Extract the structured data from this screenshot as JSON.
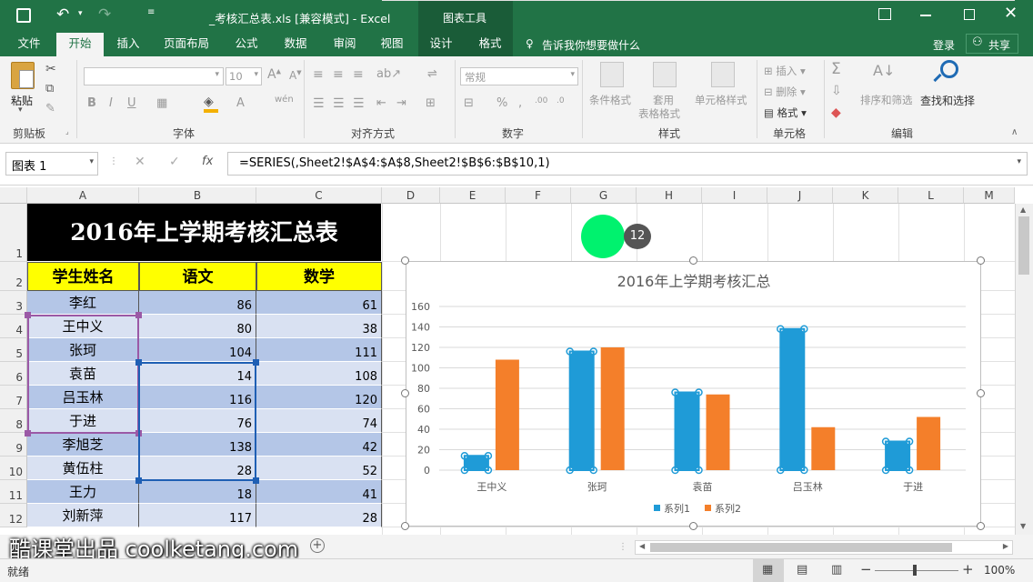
{
  "window": {
    "title": "_考核汇总表.xls  [兼容模式] - Excel",
    "context_tools": "图表工具",
    "login": "登录",
    "share": "共享"
  },
  "tabs": [
    "文件",
    "开始",
    "插入",
    "页面布局",
    "公式",
    "数据",
    "审阅",
    "视图",
    "设计",
    "格式"
  ],
  "tell_me": "告诉我你想要做什么",
  "ribbon": {
    "paste": "粘贴",
    "groups": [
      "剪贴板",
      "字体",
      "对齐方式",
      "数字",
      "样式",
      "单元格",
      "编辑"
    ],
    "font_size": "10",
    "number_format": "常规",
    "conditional_format": "条件格式",
    "table_format_1": "套用",
    "table_format_2": "表格格式",
    "cell_style": "单元格样式",
    "insert": "插入",
    "delete": "删除",
    "format": "格式",
    "sort_filter": "排序和筛选",
    "find_select": "查找和选择"
  },
  "formula_bar": {
    "name_box": "图表 1",
    "formula": "=SERIES(,Sheet2!$A$4:$A$8,Sheet2!$B$6:$B$10,1)"
  },
  "columns": [
    "A",
    "B",
    "C",
    "D",
    "E",
    "F",
    "G",
    "H",
    "I",
    "J",
    "K",
    "L",
    "M"
  ],
  "rows": [
    "1",
    "2",
    "3",
    "4",
    "5",
    "6",
    "7",
    "8",
    "9",
    "10",
    "11",
    "12"
  ],
  "sheet": {
    "title": "2016年上学期考核汇总表",
    "headers": [
      "学生姓名",
      "语文",
      "数学"
    ],
    "data": [
      [
        "李红",
        "86",
        "61"
      ],
      [
        "王中义",
        "80",
        "38"
      ],
      [
        "张珂",
        "104",
        "111"
      ],
      [
        "袁苗",
        "14",
        "108"
      ],
      [
        "吕玉林",
        "116",
        "120"
      ],
      [
        "于进",
        "76",
        "74"
      ],
      [
        "李旭芝",
        "138",
        "42"
      ],
      [
        "黄伍柱",
        "28",
        "52"
      ],
      [
        "王力",
        "18",
        "41"
      ],
      [
        "刘新萍",
        "117",
        "28"
      ]
    ]
  },
  "click_badge": "12",
  "watermark": "酷课堂出品 coolketang.com",
  "status": {
    "ready": "就绪",
    "zoom": "100%"
  },
  "colors": {
    "excel_green": "#217346",
    "series1": "#1f9bd7",
    "series2": "#f47f2a",
    "title_bg": "#000000",
    "header_bg": "#ffff00",
    "row_blue": "#b4c6e7",
    "row_light": "#d9e1f2"
  },
  "chart_data": {
    "type": "bar",
    "title": "2016年上学期考核汇总",
    "categories": [
      "王中义",
      "张珂",
      "袁苗",
      "吕玉林",
      "于进"
    ],
    "series": [
      {
        "name": "系列1",
        "values": [
          14,
          116,
          76,
          138,
          28
        ]
      },
      {
        "name": "系列2",
        "values": [
          108,
          120,
          74,
          42,
          52
        ]
      }
    ],
    "ylim": [
      0,
      160
    ],
    "yticks": [
      "0",
      "20",
      "40",
      "60",
      "80",
      "100",
      "120",
      "140",
      "160"
    ],
    "grid": true,
    "legend": "bottom"
  }
}
